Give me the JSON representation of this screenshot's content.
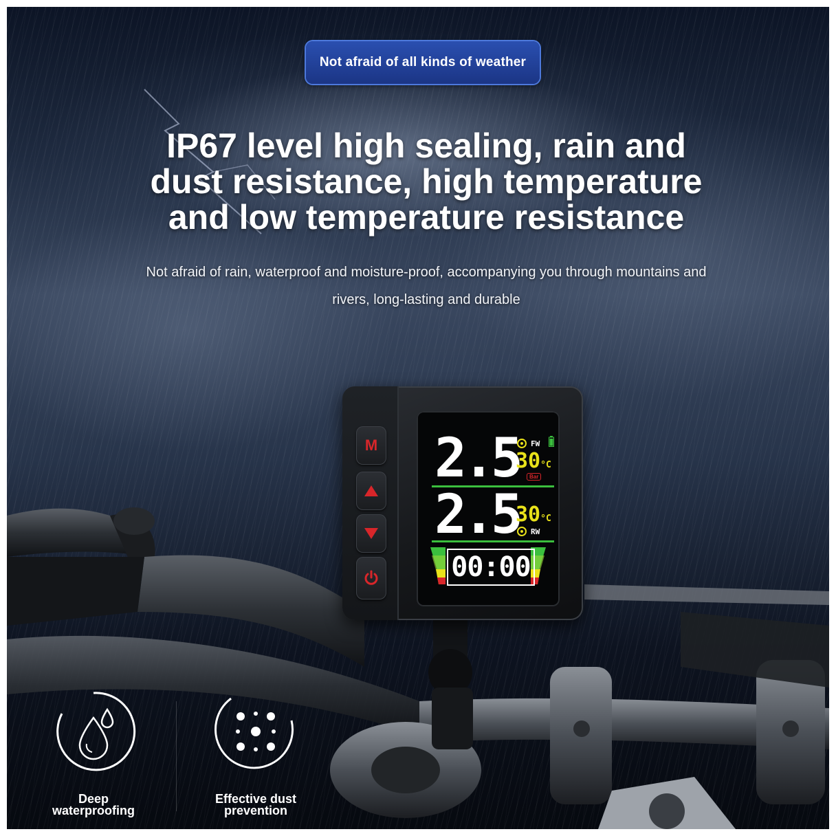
{
  "badge": {
    "text": "Not afraid of all kinds of weather"
  },
  "headline": {
    "line1": "IP67 level high sealing, rain and",
    "line2": "dust resistance, high temperature",
    "line3": "and low temperature resistance"
  },
  "subtext": {
    "line1": "Not afraid of rain, waterproof and moisture-proof, accompanying you through mountains and",
    "line2": "rivers, long-lasting and durable"
  },
  "device": {
    "buttons": {
      "mode": "M",
      "up_icon": "triangle-up-icon",
      "down_icon": "triangle-down-icon",
      "power_icon": "power-icon"
    },
    "front": {
      "pressure": "2.5",
      "temperature": "30",
      "unit": "°C",
      "label": "FW",
      "pressure_unit": "Bar"
    },
    "rear": {
      "pressure": "2.5",
      "temperature": "30",
      "unit": "°C",
      "label": "RW"
    },
    "clock": "00:00",
    "colors": {
      "button_red": "#d8262a",
      "temp_yellow": "#e9e21a",
      "divider_green": "#3bbf3e"
    }
  },
  "features": [
    {
      "line1": "Deep",
      "line2": "waterproofing",
      "icon": "water-drops-icon"
    },
    {
      "line1": "Effective dust",
      "line2": "prevention",
      "icon": "dust-dots-icon"
    }
  ],
  "colors": {
    "badge_blue": "#1f3d98",
    "text_white": "#ffffff"
  }
}
